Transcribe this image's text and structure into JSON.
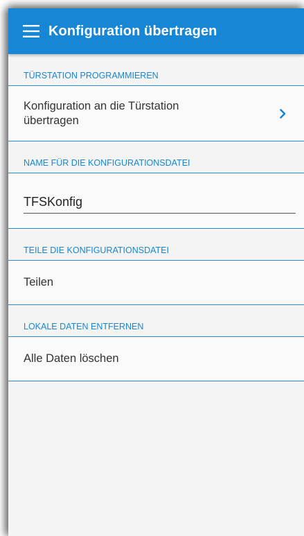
{
  "appbar": {
    "title": "Konfiguration übertragen",
    "menu_icon": "hamburger-menu-icon",
    "color": "#1786d4"
  },
  "sections": {
    "program": {
      "header": "TÜRSTATION PROGRAMMIEREN",
      "item_label": "Konfiguration an die Türstation übertragen",
      "item_icon": "chevron-right-icon"
    },
    "filename": {
      "header": "NAME FÜR DIE KONFIGURATIONSDATEI",
      "input_value": "TFSKonfig"
    },
    "share": {
      "header": "TEILE DIE KONFIGURATIONSDATEI",
      "item_label": "Teilen"
    },
    "local": {
      "header": "LOKALE DATEN ENTFERNEN",
      "item_label": "Alle Daten löschen"
    }
  }
}
